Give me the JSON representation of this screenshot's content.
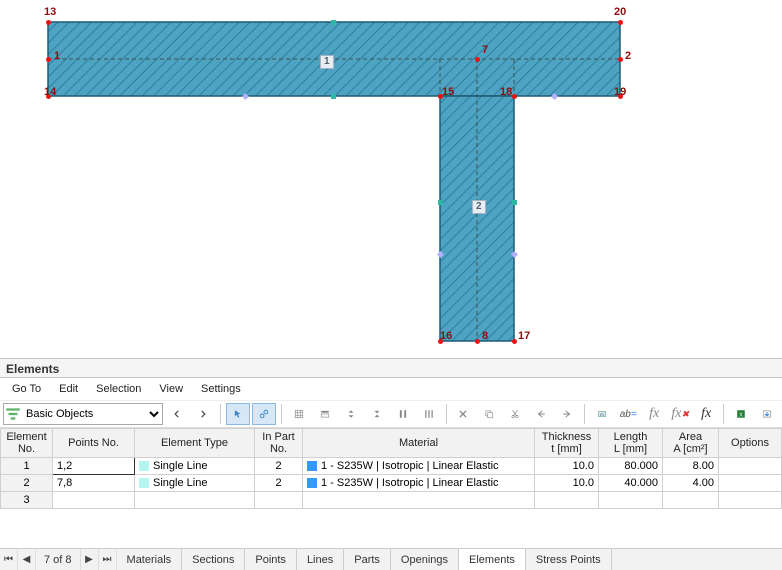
{
  "panel": {
    "title": "Elements"
  },
  "menu": {
    "goto": "Go To",
    "edit": "Edit",
    "selection": "Selection",
    "view": "View",
    "settings": "Settings"
  },
  "combo": {
    "selected": "Basic Objects"
  },
  "nodes": {
    "n1": "1",
    "n2": "2",
    "n7": "7",
    "n8": "8",
    "n13": "13",
    "n14": "14",
    "n15": "15",
    "n16": "16",
    "n17": "17",
    "n18": "18",
    "n19": "19",
    "n20": "20"
  },
  "element_boxes": {
    "e1": "1",
    "e2": "2"
  },
  "table": {
    "headers": {
      "elem_no": "Element\nNo.",
      "points_no": "Points No.",
      "elem_type": "Element Type",
      "part_no": "In Part\nNo.",
      "material": "Material",
      "thickness": "Thickness\nt [mm]",
      "length": "Length\nL [mm]",
      "area": "Area\nA [cm²]",
      "options": "Options"
    },
    "rows": [
      {
        "no": "1",
        "points": "1,2",
        "type": "Single Line",
        "part": "2",
        "material": "1 - S235W | Isotropic | Linear Elastic",
        "t": "10.0",
        "L": "80.000",
        "A": "8.00",
        "options": ""
      },
      {
        "no": "2",
        "points": "7,8",
        "type": "Single Line",
        "part": "2",
        "material": "1 - S235W | Isotropic | Linear Elastic",
        "t": "10.0",
        "L": "40.000",
        "A": "4.00",
        "options": ""
      },
      {
        "no": "3",
        "points": "",
        "type": "",
        "part": "",
        "material": "",
        "t": "",
        "L": "",
        "A": "",
        "options": ""
      }
    ]
  },
  "tabs": {
    "nav": "7 of 8",
    "items": [
      "Materials",
      "Sections",
      "Points",
      "Lines",
      "Parts",
      "Openings",
      "Elements",
      "Stress Points"
    ],
    "active": "Elements"
  }
}
